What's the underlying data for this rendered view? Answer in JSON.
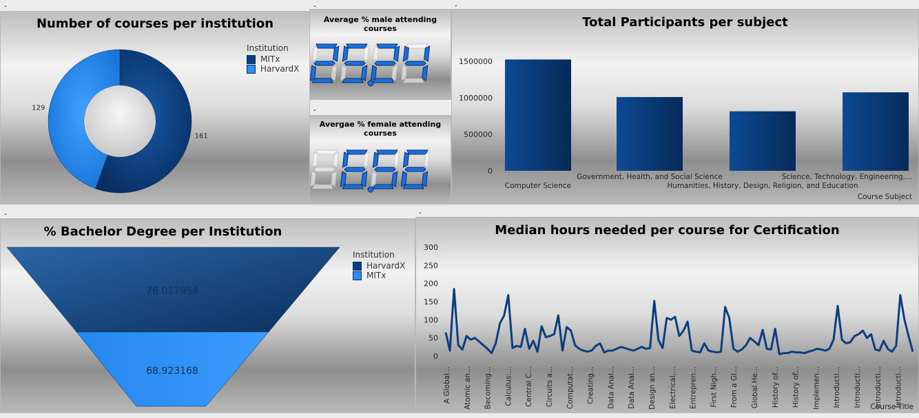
{
  "colors": {
    "dark_blue": "#0b3e7e",
    "light_blue": "#2a8df0",
    "lcd_digit": "#1a6fe0"
  },
  "donut": {
    "title": "Number of courses per institution",
    "legend_title": "Institution",
    "legend_items": [
      "MITx",
      "HarvardX"
    ],
    "chart_data": {
      "type": "pie",
      "title": "Number of courses per institution",
      "categories": [
        "MITx",
        "HarvardX"
      ],
      "values": [
        161,
        129
      ],
      "labels": [
        "161",
        "129"
      ]
    }
  },
  "kpi_male": {
    "title": "Average % male attending courses",
    "value": "25.24"
  },
  "kpi_female": {
    "title": "Avergae % female attending courses",
    "value": "6.56"
  },
  "bar": {
    "title": "Total Participants per subject",
    "axis_title": "Course Subject",
    "chart_data": {
      "type": "bar",
      "title": "Total Participants per subject",
      "xlabel": "Course Subject",
      "categories": [
        "Computer Science",
        "Government, Health, and Social Science",
        "Humanities, History, Design, Religion, and Education",
        "Science, Technology, Engineering,..."
      ],
      "values": [
        1525000,
        1010000,
        815000,
        1075000
      ],
      "ylim": [
        0,
        1500000
      ],
      "yticks": [
        "0",
        "500000",
        "1000000",
        "1500000"
      ]
    }
  },
  "funnel": {
    "title": "% Bachelor Degree per Institution",
    "legend_title": "Institution",
    "legend_items": [
      "HarvardX",
      "MITx"
    ],
    "chart_data": {
      "type": "funnel",
      "title": "% Bachelor Degree per Institution",
      "categories": [
        "HarvardX",
        "MITx"
      ],
      "values": [
        76.017954,
        68.923168
      ],
      "labels": [
        "76.017954",
        "68.923168"
      ]
    }
  },
  "line": {
    "title": "Median hours needed per course for Certification",
    "axis_title": "Course Title",
    "chart_data": {
      "type": "line",
      "title": "Median hours needed per course for Certification",
      "xlabel": "Course Title",
      "ylim": [
        0,
        300
      ],
      "yticks": [
        "0",
        "50",
        "100",
        "150",
        "200",
        "250",
        "300"
      ],
      "x_tick_labels": [
        "A Global...",
        "Atomic an...",
        "Becoming...",
        "Calculus:...",
        "Central C...",
        "Circuits a...",
        "Computat...",
        "Creating...",
        "Data Anal...",
        "Data Anal...",
        "Design an...",
        "Electrical,...",
        "Entrepren...",
        "First Nigh...",
        "From a Gl...",
        "Global He...",
        "History of...",
        "History of...",
        "Implemen...",
        "Introducti...",
        "Introducti...",
        "Introducti...",
        "Introducti..."
      ],
      "values": [
        65,
        15,
        185,
        30,
        18,
        55,
        45,
        50,
        40,
        30,
        20,
        8,
        35,
        90,
        112,
        168,
        22,
        28,
        25,
        75,
        20,
        42,
        12,
        82,
        52,
        55,
        60,
        112,
        15,
        80,
        70,
        30,
        20,
        15,
        12,
        15,
        28,
        35,
        10,
        15,
        15,
        20,
        25,
        22,
        18,
        15,
        20,
        25,
        20,
        22,
        152,
        45,
        22,
        105,
        100,
        108,
        55,
        70,
        95,
        15,
        12,
        10,
        35,
        15,
        12,
        10,
        12,
        135,
        105,
        20,
        12,
        18,
        30,
        50,
        40,
        30,
        72,
        20,
        18,
        75,
        5,
        8,
        8,
        12,
        10,
        10,
        8,
        12,
        15,
        20,
        18,
        15,
        20,
        45,
        138,
        45,
        35,
        38,
        55,
        60,
        70,
        50,
        60,
        18,
        15,
        42,
        20,
        12,
        28,
        168,
        100,
        55,
        12
      ]
    }
  }
}
